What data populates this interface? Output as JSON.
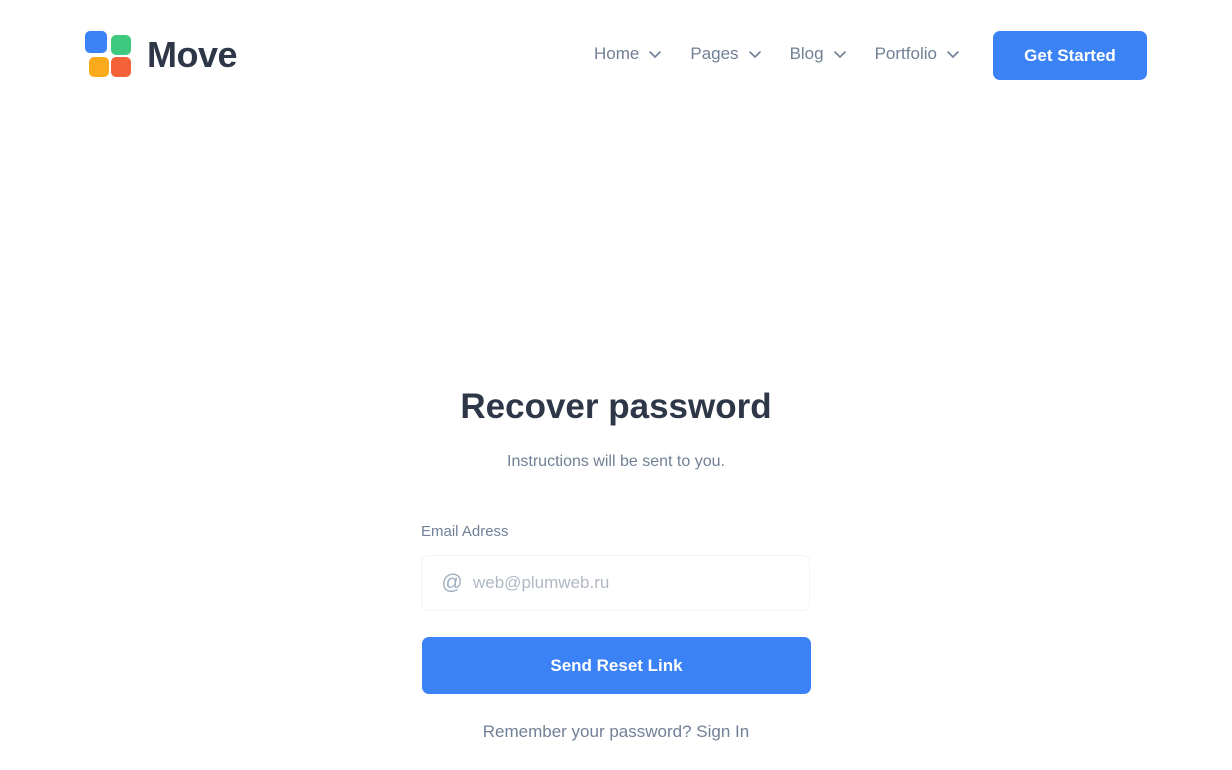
{
  "brand": {
    "name": "Move",
    "logo_colors": {
      "blue": "#3b82f6",
      "green": "#3ec97e",
      "yellow": "#fbaa1c",
      "red": "#f4623a"
    }
  },
  "nav": {
    "items": [
      {
        "label": "Home",
        "icon": "chevron-down-icon"
      },
      {
        "label": "Pages",
        "icon": "chevron-down-icon"
      },
      {
        "label": "Blog",
        "icon": "chevron-down-icon"
      },
      {
        "label": "Portfolio",
        "icon": "chevron-down-icon"
      }
    ],
    "cta_label": "Get Started"
  },
  "form": {
    "title": "Recover password",
    "subtitle": "Instructions will be sent to you.",
    "email_label": "Email Adress",
    "email_placeholder": "web@plumweb.ru",
    "email_icon": "at-icon",
    "submit_label": "Send Reset Link",
    "remember_text": "Remember your password?",
    "sign_in_label": "Sign In"
  },
  "colors": {
    "accent": "#3b82f6",
    "heading": "#2d3748",
    "muted": "#718096"
  }
}
